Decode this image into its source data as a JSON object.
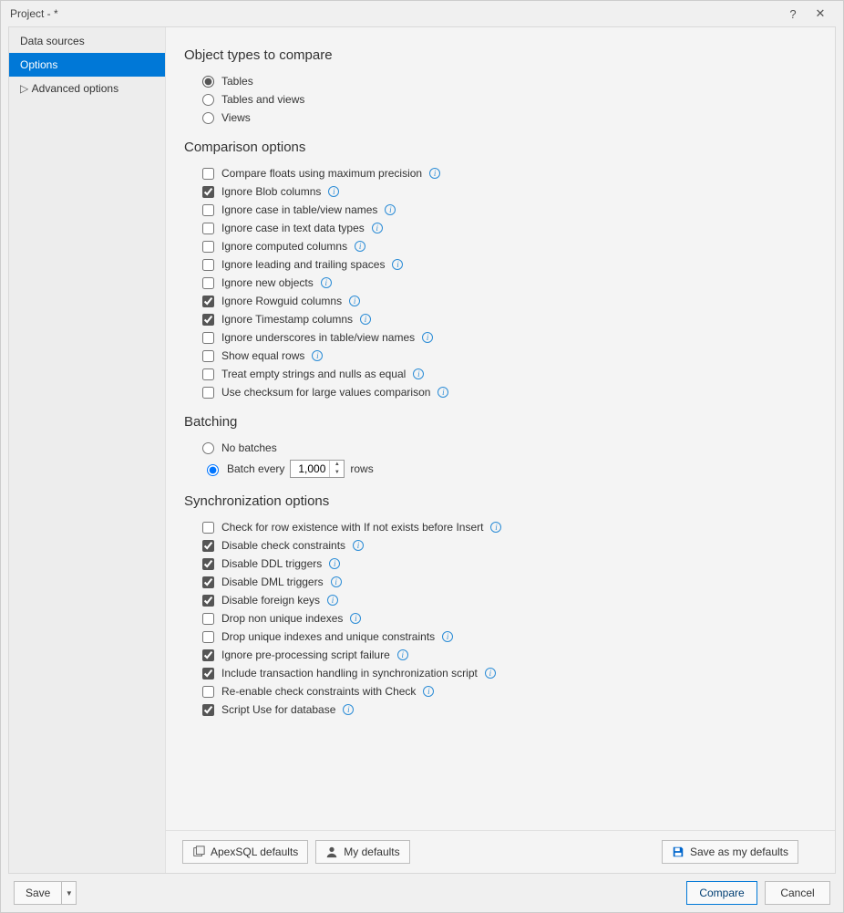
{
  "window": {
    "title": "Project - *"
  },
  "sidebar": {
    "items": [
      {
        "label": "Data sources",
        "selected": false,
        "expandable": false
      },
      {
        "label": "Options",
        "selected": true,
        "expandable": false
      },
      {
        "label": "Advanced options",
        "selected": false,
        "expandable": true
      }
    ]
  },
  "sections": {
    "object_types": {
      "title": "Object types to compare",
      "options": [
        {
          "label": "Tables",
          "checked": true
        },
        {
          "label": "Tables and views",
          "checked": false
        },
        {
          "label": "Views",
          "checked": false
        }
      ]
    },
    "comparison": {
      "title": "Comparison options",
      "options": [
        {
          "label": "Compare floats using maximum precision",
          "checked": false
        },
        {
          "label": "Ignore Blob columns",
          "checked": true
        },
        {
          "label": "Ignore case in table/view names",
          "checked": false
        },
        {
          "label": "Ignore case in text data types",
          "checked": false
        },
        {
          "label": "Ignore computed columns",
          "checked": false
        },
        {
          "label": "Ignore leading and trailing spaces",
          "checked": false
        },
        {
          "label": "Ignore new objects",
          "checked": false
        },
        {
          "label": "Ignore Rowguid columns",
          "checked": true
        },
        {
          "label": "Ignore Timestamp columns",
          "checked": true
        },
        {
          "label": "Ignore underscores in table/view names",
          "checked": false
        },
        {
          "label": "Show equal rows",
          "checked": false
        },
        {
          "label": "Treat empty strings and nulls as equal",
          "checked": false
        },
        {
          "label": "Use checksum for large values comparison",
          "checked": false
        }
      ]
    },
    "batching": {
      "title": "Batching",
      "no_batches_label": "No batches",
      "batch_every_label": "Batch every",
      "rows_label": "rows",
      "value": "1,000",
      "selected": "batch_every"
    },
    "sync": {
      "title": "Synchronization options",
      "options": [
        {
          "label": "Check for row existence with If not exists before Insert",
          "checked": false
        },
        {
          "label": "Disable check constraints",
          "checked": true
        },
        {
          "label": "Disable DDL triggers",
          "checked": true
        },
        {
          "label": "Disable DML triggers",
          "checked": true
        },
        {
          "label": "Disable foreign keys",
          "checked": true
        },
        {
          "label": "Drop non unique indexes",
          "checked": false
        },
        {
          "label": "Drop unique indexes and unique constraints",
          "checked": false
        },
        {
          "label": "Ignore pre-processing script failure",
          "checked": true
        },
        {
          "label": "Include transaction handling in synchronization script",
          "checked": true
        },
        {
          "label": "Re-enable check constraints with Check",
          "checked": false
        },
        {
          "label": "Script Use for database",
          "checked": true
        }
      ]
    }
  },
  "buttons": {
    "apex_defaults": "ApexSQL defaults",
    "my_defaults": "My defaults",
    "save_defaults": "Save as my defaults",
    "save": "Save",
    "compare": "Compare",
    "cancel": "Cancel"
  }
}
